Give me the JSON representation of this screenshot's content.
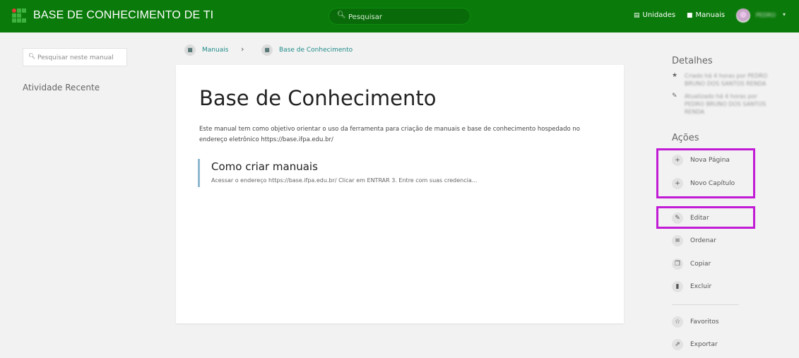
{
  "header": {
    "title": "BASE DE CONHECIMENTO DE TI",
    "search_placeholder": "Pesquisar",
    "units_label": "Unidades",
    "manuals_label": "Manuais",
    "user_name": "PEDRO"
  },
  "sidebar": {
    "search_placeholder": "Pesquisar neste manual",
    "recent_title": "Atividade Recente"
  },
  "breadcrumb": {
    "items": [
      "Manuais",
      "Base de Conhecimento"
    ]
  },
  "book": {
    "title": "Base de Conhecimento",
    "description": "Este manual tem como objetivo orientar o uso da ferramenta para criação de manuais e base de conhecimento hospedado no endereço eletrônico https://base.ifpa.edu.br/",
    "chapter_title": "Como criar manuais",
    "chapter_excerpt": "Acessar o endereço https://base.ifpa.edu.br/ Clicar em ENTRAR 3. Entre com suas credencia..."
  },
  "details": {
    "title": "Detalhes",
    "created": "Criado há 4 horas por PEDRO BRUNO DOS SANTOS RENDA",
    "updated": "Atualizado há 4 horas por PEDRO BRUNO DOS SANTOS RENDA"
  },
  "actions": {
    "title": "Ações",
    "new_page": "Nova Página",
    "new_chapter": "Novo Capítulo",
    "edit": "Editar",
    "sort": "Ordenar",
    "copy": "Copiar",
    "delete": "Excluir",
    "favorites": "Favoritos",
    "export": "Exportar"
  },
  "colors": {
    "header_bg": "#0a7a0a",
    "highlight": "#c21bd6",
    "link": "#1f8a88"
  }
}
